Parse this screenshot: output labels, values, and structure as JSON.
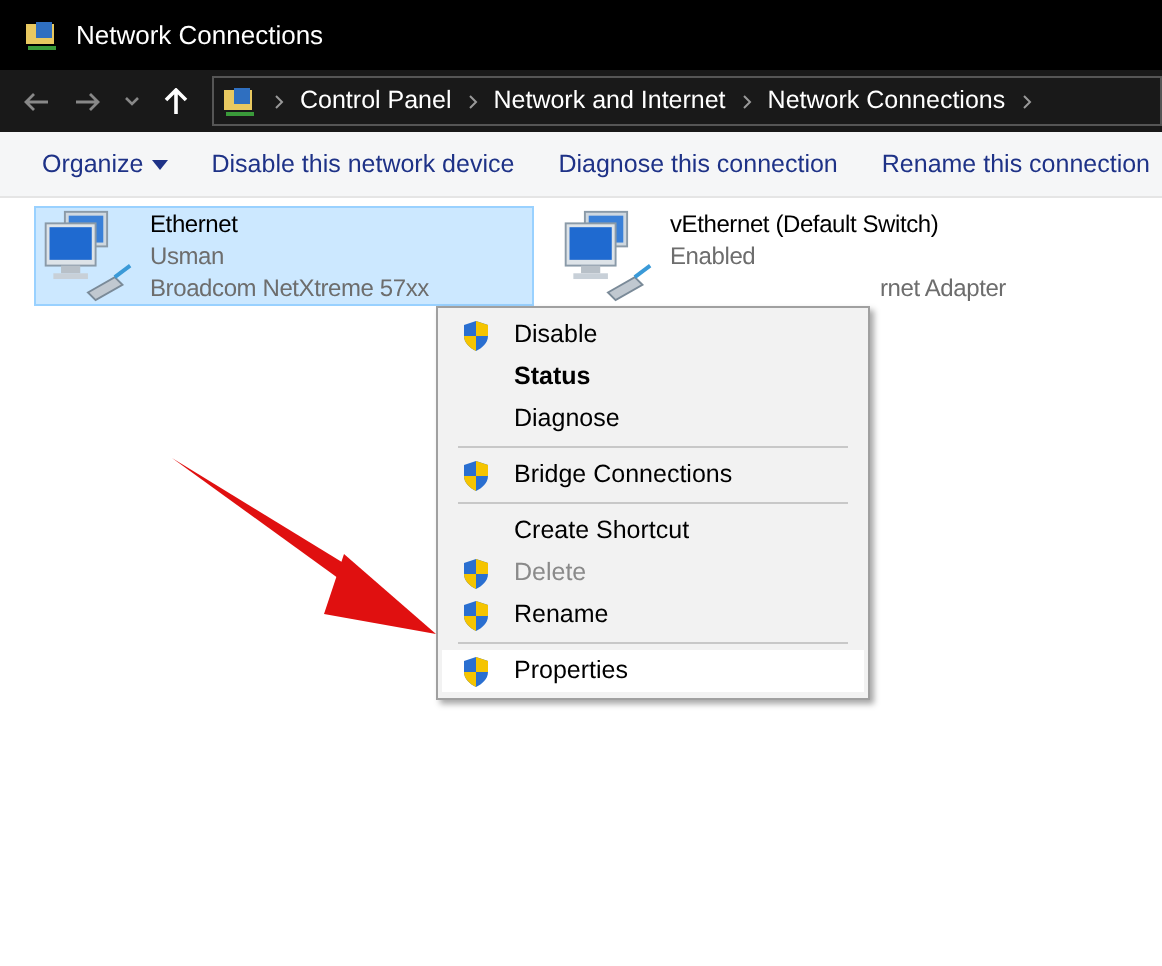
{
  "window": {
    "title": "Network Connections"
  },
  "breadcrumb": [
    "Control Panel",
    "Network and Internet",
    "Network Connections"
  ],
  "toolbar": [
    {
      "label": "Organize",
      "dropdown": true
    },
    {
      "label": "Disable this network device",
      "dropdown": false
    },
    {
      "label": "Diagnose this connection",
      "dropdown": false
    },
    {
      "label": "Rename this connection",
      "dropdown": false
    }
  ],
  "connections": [
    {
      "name": "Ethernet",
      "status": "Usman",
      "adapter": "Broadcom NetXtreme 57xx",
      "selected": true
    },
    {
      "name": "vEthernet (Default Switch)",
      "status": "Enabled",
      "adapter": "rnet Adapter",
      "selected": false
    }
  ],
  "context_menu": [
    {
      "kind": "item",
      "label": "Disable",
      "shield": true,
      "bold": false,
      "disabled": false,
      "selected": false
    },
    {
      "kind": "item",
      "label": "Status",
      "shield": false,
      "bold": true,
      "disabled": false,
      "selected": false
    },
    {
      "kind": "item",
      "label": "Diagnose",
      "shield": false,
      "bold": false,
      "disabled": false,
      "selected": false
    },
    {
      "kind": "separator"
    },
    {
      "kind": "item",
      "label": "Bridge Connections",
      "shield": true,
      "bold": false,
      "disabled": false,
      "selected": false
    },
    {
      "kind": "separator"
    },
    {
      "kind": "item",
      "label": "Create Shortcut",
      "shield": false,
      "bold": false,
      "disabled": false,
      "selected": false
    },
    {
      "kind": "item",
      "label": "Delete",
      "shield": true,
      "bold": false,
      "disabled": true,
      "selected": false
    },
    {
      "kind": "item",
      "label": "Rename",
      "shield": true,
      "bold": false,
      "disabled": false,
      "selected": false
    },
    {
      "kind": "separator"
    },
    {
      "kind": "item",
      "label": "Properties",
      "shield": true,
      "bold": false,
      "disabled": false,
      "selected": true
    }
  ]
}
